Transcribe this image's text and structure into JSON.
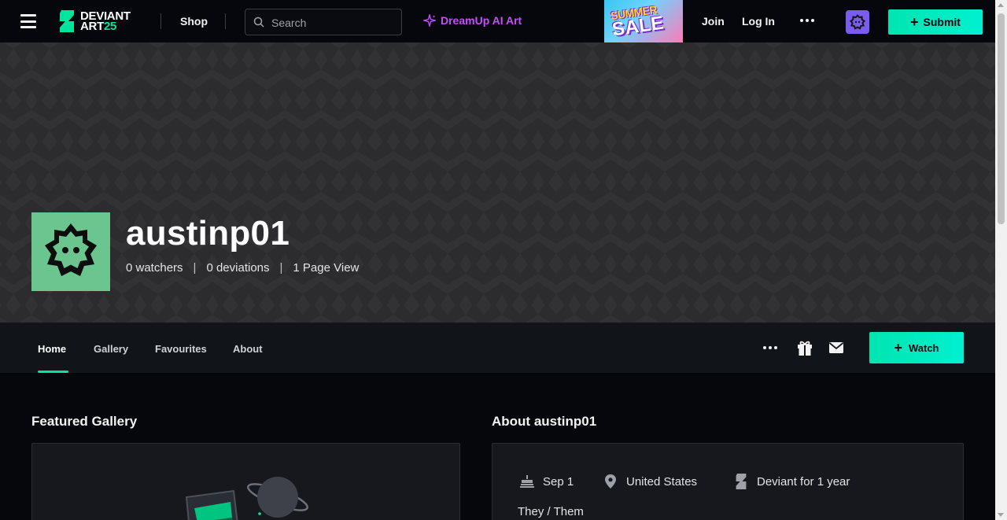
{
  "header": {
    "logo": {
      "line1": "DEVIANT",
      "line2": "ART",
      "line2_num": "25"
    },
    "shop_label": "Shop",
    "search": {
      "placeholder": "Search"
    },
    "dreamup_label": "DreamUp AI Art",
    "sale_banner": {
      "line1": "SUMMER",
      "line2": "SALE"
    },
    "join_label": "Join",
    "login_label": "Log In",
    "submit_label": "Submit"
  },
  "profile": {
    "username": "austinp01",
    "stats": {
      "watchers": "0 watchers",
      "separator": "|",
      "deviations": "0 deviations",
      "page_views": "1 Page View"
    },
    "avatar_color": "#6bc58e"
  },
  "tabs": [
    {
      "label": "Home",
      "active": true
    },
    {
      "label": "Gallery",
      "active": false
    },
    {
      "label": "Favourites",
      "active": false
    },
    {
      "label": "About",
      "active": false
    }
  ],
  "actions": {
    "watch_label": "Watch"
  },
  "featured_gallery": {
    "title": "Featured Gallery"
  },
  "about": {
    "title": "About austinp01",
    "birthday": "Sep 1",
    "location": "United States",
    "member_for": "Deviant for 1 year",
    "pronouns": "They / Them"
  },
  "colors": {
    "accent": "#00e59b",
    "dreamup": "#c64ef8",
    "background": "#06070d",
    "banner": "#2c2c2e"
  },
  "icons": [
    "menu-icon",
    "deviantart-logo-icon",
    "search-icon",
    "sparkle-icon",
    "more-icon",
    "user-avatar-icon",
    "plus-icon",
    "gift-icon",
    "mail-icon",
    "cake-icon",
    "location-pin-icon",
    "deviantart-icon"
  ]
}
